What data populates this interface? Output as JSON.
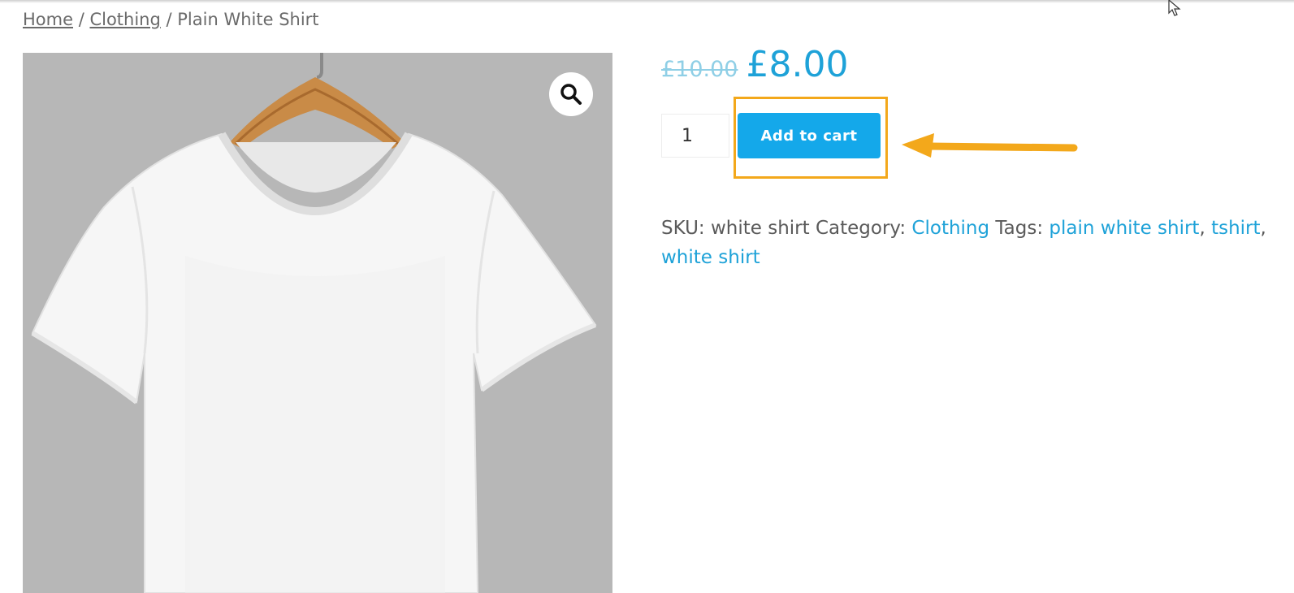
{
  "breadcrumb": {
    "home": "Home",
    "sep1": " / ",
    "category": "Clothing",
    "sep2": " / ",
    "current": "Plain White Shirt"
  },
  "product": {
    "price_old": "£10.00",
    "price_new": "£8.00",
    "quantity": "1",
    "add_to_cart_label": "Add to cart"
  },
  "meta": {
    "sku_label": "SKU: ",
    "sku_value": "white shirt",
    "category_label": " Category: ",
    "category_value": "Clothing",
    "tags_label": " Tags: ",
    "tags": [
      "plain white shirt",
      "tshirt",
      "white shirt"
    ],
    "tag_sep": ", "
  },
  "icons": {
    "zoom": "magnifier-icon",
    "annotation": "arrow-left-icon",
    "cursor": "mouse-pointer-icon"
  },
  "colors": {
    "accent": "#1ea2d8",
    "button": "#14a8ea",
    "annotation": "#f3a81b",
    "image_bg": "#b8b8b8"
  }
}
